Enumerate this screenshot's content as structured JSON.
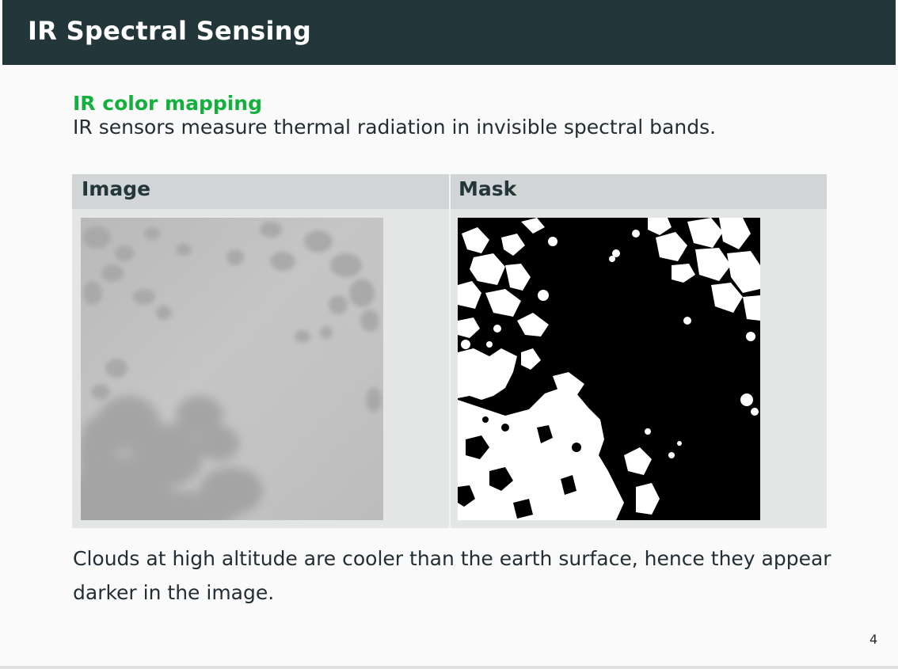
{
  "header": {
    "title": "IR Spectral Sensing"
  },
  "block": {
    "title": "IR color mapping",
    "text": "IR sensors measure thermal radiation in invisible spectral bands."
  },
  "table": {
    "columns": [
      "Image",
      "Mask"
    ]
  },
  "caption": "Clouds at high altitude are cooler than the earth surface, hence they appear darker in the image.",
  "page_number": "4",
  "colors": {
    "header_bg": "#23373b",
    "accent_green": "#14b03d",
    "table_head_bg": "#d1d5d5",
    "table_body_bg": "#e4e6e6"
  }
}
